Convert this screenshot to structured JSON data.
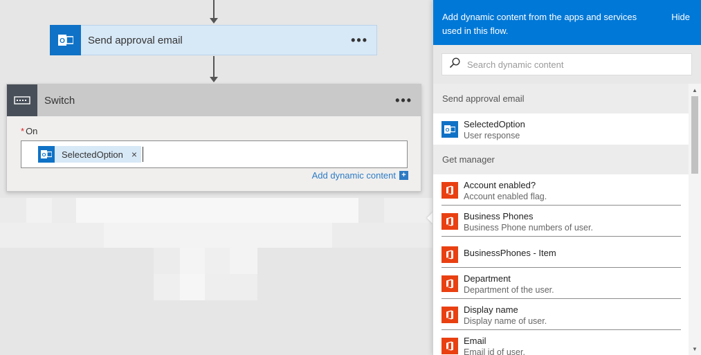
{
  "flow": {
    "approval_card": {
      "title": "Send approval email",
      "menu": "•••"
    },
    "switch_card": {
      "title": "Switch",
      "menu": "•••",
      "on_required": "*",
      "on_label": "On",
      "token_label": "SelectedOption",
      "token_remove": "×",
      "add_dynamic_label": "Add dynamic content",
      "add_dynamic_plus": "+"
    }
  },
  "panel": {
    "title": "Add dynamic content from the apps and services used in this flow.",
    "hide_label": "Hide",
    "search_placeholder": "Search dynamic content",
    "sections": [
      {
        "name": "Send approval email",
        "items": [
          {
            "name": "SelectedOption",
            "desc": "User response",
            "icon": "outlook-icon"
          }
        ]
      },
      {
        "name": "Get manager",
        "items": [
          {
            "name": "Account enabled?",
            "desc": "Account enabled flag.",
            "icon": "office-icon"
          },
          {
            "name": "Business Phones",
            "desc": "Business Phone numbers of user.",
            "icon": "office-icon"
          },
          {
            "name": "BusinessPhones - Item",
            "desc": "",
            "icon": "office-icon"
          },
          {
            "name": "Department",
            "desc": "Department of the user.",
            "icon": "office-icon"
          },
          {
            "name": "Display name",
            "desc": "Display name of user.",
            "icon": "office-icon"
          },
          {
            "name": "Email",
            "desc": "Email id of user.",
            "icon": "office-icon"
          }
        ]
      }
    ]
  },
  "colors": {
    "accent": "#0078d7",
    "outlook": "#0f72c6",
    "office": "#e94012",
    "link": "#2d7bc4"
  }
}
